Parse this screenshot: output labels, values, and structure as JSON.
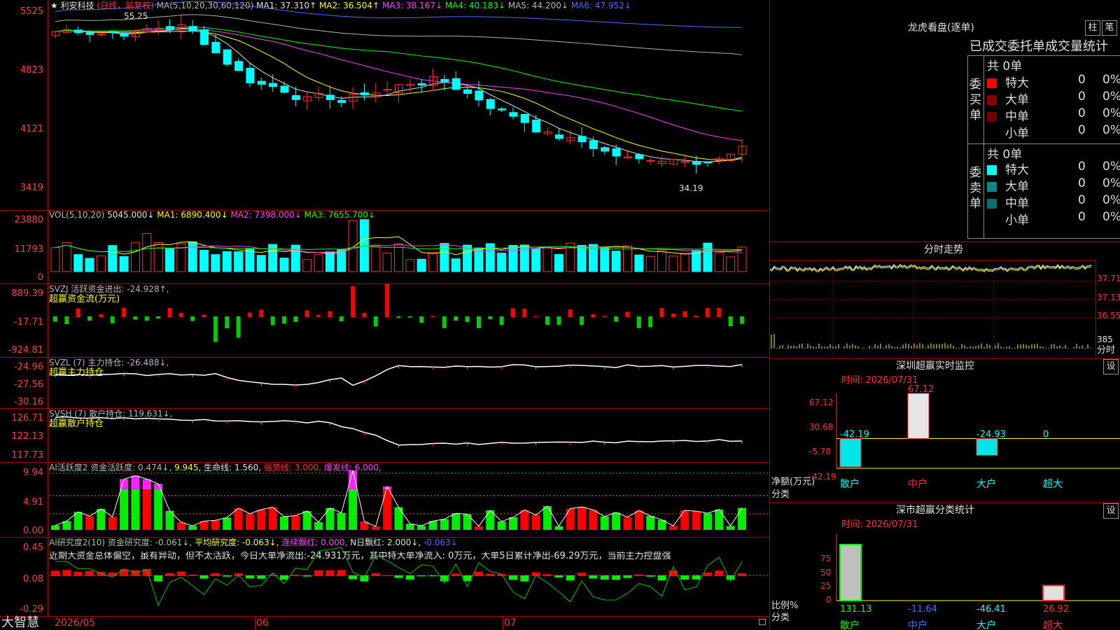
{
  "header": {
    "star": "★",
    "stock_name": "利安科技",
    "period": "(日线，前复权)",
    "ma_label": "MA(5,10,20,30,60,120)",
    "ma1": "MA1: 37.310↑",
    "ma2": "MA2: 36.504↑",
    "ma3": "MA3: 38.167↓",
    "ma4": "MA4: 40.183↓",
    "ma5": "MA5: 44.200↓",
    "ma6": "MA6: 47.952↓",
    "high_mark": "55.25",
    "low_mark": "34.19"
  },
  "price_axis": [
    "5525",
    "4823",
    "4121",
    "3419"
  ],
  "vol": {
    "label": "VOL(5,10,20)",
    "value": "5045.000↓",
    "ma1": "MA1: 6890.400↓",
    "ma2": "MA2: 7398.000↓",
    "ma3": "MA3: 7655.700↓",
    "axis": [
      "23880",
      "11793",
      "0"
    ]
  },
  "svzj": {
    "label": "SVZJ  活跃资金进出: -24.928↑,",
    "sub": "超赢资金流(万元)",
    "axis": [
      "889.39",
      "-17.71",
      "-924.81"
    ]
  },
  "svzl": {
    "label": "SVZL (7) 主力持仓: -26.488↓,",
    "sub": "超赢主力持仓",
    "axis": [
      "-24.96",
      "-27.56",
      "-30.16"
    ]
  },
  "svsh": {
    "label": "SVSH (7) 散户持仓: 119.631↓,",
    "sub": "超赢散户持仓",
    "axis": [
      "126.71",
      "122.13",
      "117.73"
    ]
  },
  "ai_active": {
    "label": "AI活跃度2 资金活跃度: 0.474↓,",
    "val2": "9.945,",
    "life": "生命线: 1.560,",
    "strong": "强势线: 3.000,",
    "burst": "爆发线: 6.000,",
    "axis": [
      "9.94",
      "4.91",
      "0.00"
    ]
  },
  "ai_research": {
    "label": "AI研究度2(10) 资金研究度: -0.061↓,",
    "avg": "平均研究度: -0.063↓,",
    "cont": "连续飘红: 0.000,",
    "nday": "N日飘红: 2.000↓,",
    "last": "-0.063↓",
    "comment": "近期大资金总体偏空，虽有异动，但不太活跃，今日大单净流出:-24.931万元，其中特大单净流入: 0万元，大单5日累计净出-69.29万元，当前主力控盘强",
    "axis": [
      "0.45",
      "0.08",
      "-0.29"
    ]
  },
  "bottom": {
    "logo": "大智慧",
    "dates": [
      "2026/05",
      "06",
      "07"
    ]
  },
  "right_panel": {
    "title": "龙虎看盘(逐单)",
    "btn1": "柱",
    "btn2": "笔",
    "tab": "已成交委托单成交量统计",
    "buy_side": "委买单",
    "sell_side": "委卖单",
    "buy_total": "共 0单",
    "sell_total": "共 0单",
    "buy_rows": [
      {
        "name": "特大",
        "count": "0",
        "pct": "0%",
        "color": "#ff0000"
      },
      {
        "name": "大单",
        "count": "0",
        "pct": "0%",
        "color": "#8b0000"
      },
      {
        "name": "中单",
        "count": "0",
        "pct": "0%",
        "color": "#700000"
      },
      {
        "name": "小单",
        "count": "0",
        "pct": "0%",
        "color": ""
      }
    ],
    "sell_rows": [
      {
        "name": "特大",
        "count": "0",
        "pct": "0%",
        "color": "#00ffff"
      },
      {
        "name": "大单",
        "count": "0",
        "pct": "0%",
        "color": "#008b8b"
      },
      {
        "name": "中单",
        "count": "0",
        "pct": "0%",
        "color": "#007070"
      },
      {
        "name": "小单",
        "count": "0",
        "pct": "0%",
        "color": ""
      }
    ],
    "intraday_title": "分时走势",
    "intraday_axis": [
      "37.71",
      "37.13",
      "36.55",
      "385",
      "分时"
    ],
    "monitor_title": "深圳超赢实时监控",
    "monitor_set": "设",
    "monitor_time": "时间: 2026/07/31",
    "monitor_axis": [
      "67.12",
      "30.68",
      "-5.78",
      "-42.19"
    ],
    "monitor_values": [
      "-42.19",
      "67.12",
      "-24.93",
      "0"
    ],
    "monitor_ylabel": "净额(万元)",
    "monitor_xlabel": "分类",
    "categories": [
      "散户",
      "中户",
      "大户",
      "超大"
    ],
    "class_title": "深市超赢分类统计",
    "class_set": "设",
    "class_time": "时间: 2026/07/31",
    "class_axis": [
      "75",
      "50",
      "25",
      "0"
    ],
    "class_values": [
      "131.13",
      "-11.64",
      "-46.41",
      "26.92"
    ],
    "class_ylabel": "比例%",
    "class_xlabel": "分类"
  },
  "chart_data": {
    "type": "bar",
    "categories": [
      "散户",
      "中户",
      "大户",
      "超大"
    ],
    "series": [
      {
        "values": [
          -42.19,
          67.12,
          -24.93,
          0
        ]
      }
    ],
    "ylim": [
      -42.19,
      67.12
    ]
  }
}
